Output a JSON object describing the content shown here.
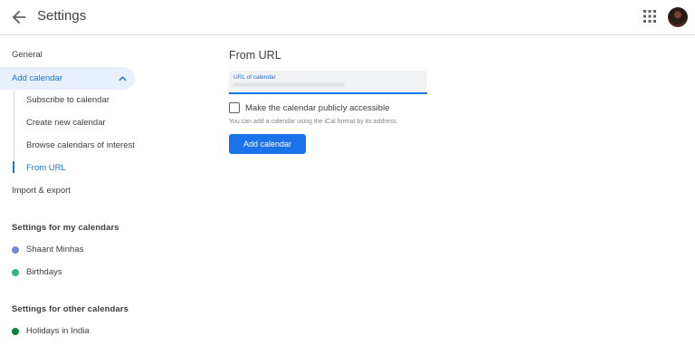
{
  "header": {
    "title": "Settings",
    "back_icon": "arrow-left-icon",
    "apps_icon": "apps-grid-icon",
    "avatar_icon": "user-avatar"
  },
  "sidebar": {
    "general": "General",
    "add_calendar": "Add calendar",
    "add_calendar_subitems": [
      "Subscribe to calendar",
      "Create new calendar",
      "Browse calendars of interest",
      "From URL"
    ],
    "active_subitem": "From URL",
    "import_export": "Import & export",
    "my_calendars_heading": "Settings for my calendars",
    "my_calendars": [
      {
        "name": "Shaant Minhas",
        "color": "#7986cb"
      },
      {
        "name": "Birthdays",
        "color": "#33b679"
      }
    ],
    "other_calendars_heading": "Settings for other calendars",
    "other_calendars": [
      {
        "name": "Holidays in India",
        "color": "#0b8043"
      }
    ]
  },
  "main": {
    "title": "From URL",
    "url_field": {
      "label": "URL of calendar"
    },
    "public_checkbox": {
      "label": "Make the calendar publicly accessible",
      "checked": false
    },
    "help_text": "You can add a calendar using the iCal format by its address.",
    "submit_label": "Add calendar"
  },
  "colors": {
    "accent": "#1a73e8",
    "selected_bg": "#e8f0fe"
  }
}
